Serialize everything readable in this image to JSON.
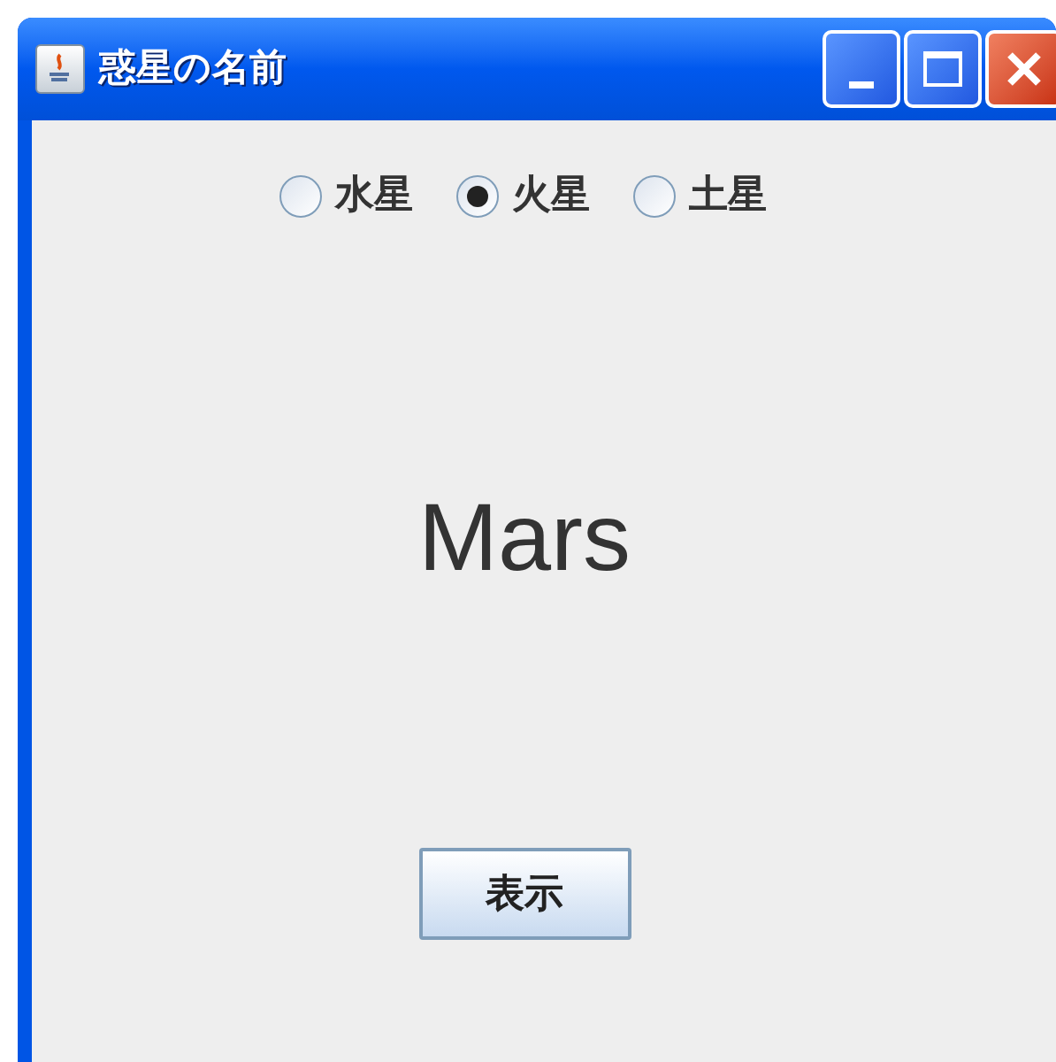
{
  "window": {
    "title": "惑星の名前"
  },
  "planets": [
    {
      "label": "水星",
      "selected": false
    },
    {
      "label": "火星",
      "selected": true
    },
    {
      "label": "土星",
      "selected": false
    }
  ],
  "display": "Mars",
  "button": "表示"
}
